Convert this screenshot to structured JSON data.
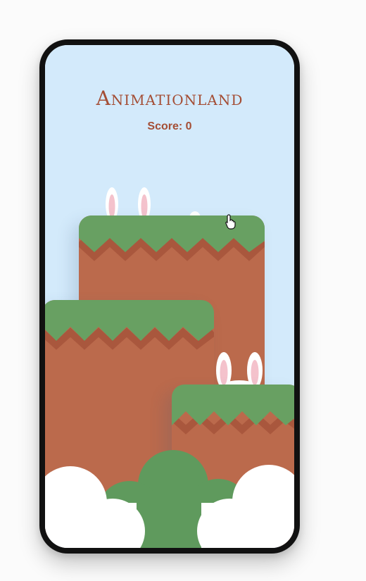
{
  "app": {
    "title": "Animationland",
    "score_label": "Score:",
    "score_value": "0"
  },
  "colors": {
    "sky": "#d3eafb",
    "dirt": "#bb6a4c",
    "dirt_zigzag": "#a9573d",
    "grass": "#68a062",
    "bush": "#5f9a5d",
    "cloud": "#ffffff",
    "bunny_ear_outer": "#ffffff",
    "bunny_ear_inner": "#f4c2cc",
    "title_color": "#a44e35",
    "frame": "#111111"
  },
  "scene": {
    "platforms": [
      "top-center-platform",
      "left-platform",
      "right-platform"
    ],
    "bunnies": [
      {
        "id": "bunny-top",
        "state": "peeking"
      },
      {
        "id": "bunny-right",
        "state": "peeking"
      }
    ],
    "cursor_icon": "hand-pointer-icon"
  }
}
